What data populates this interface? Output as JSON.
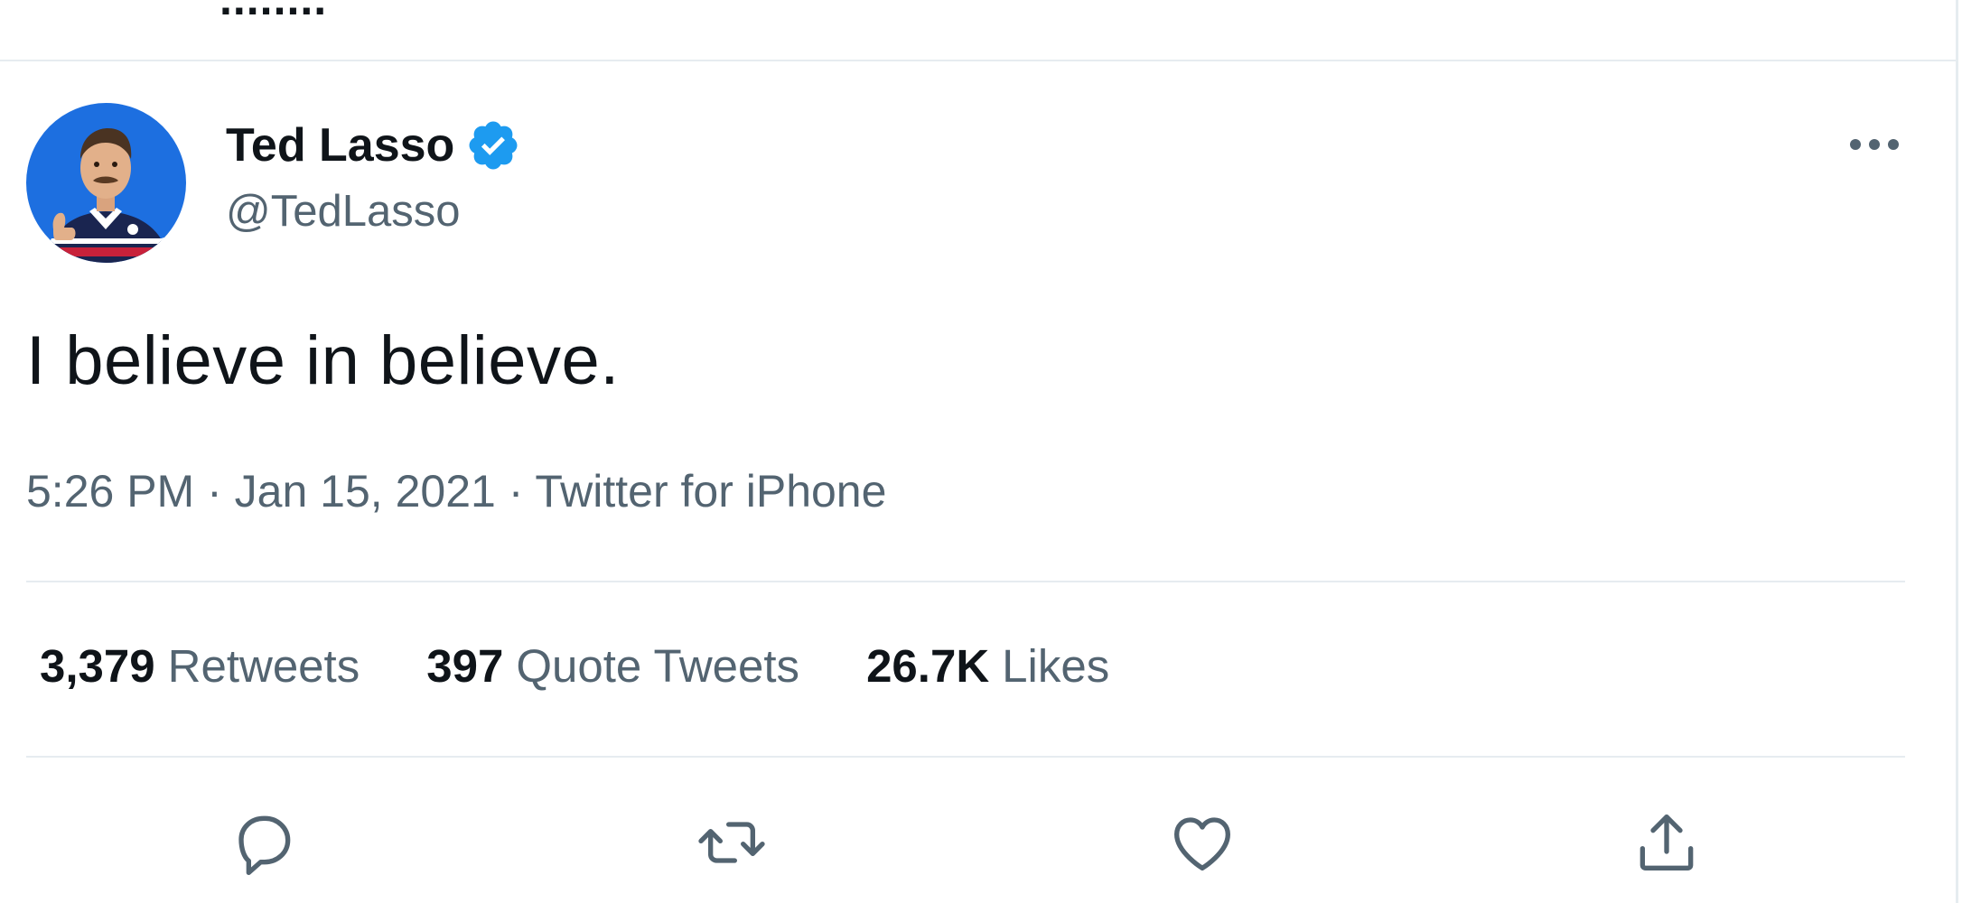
{
  "previous_tweet": {
    "partial_text": "........"
  },
  "tweet": {
    "author": {
      "display_name": "Ted Lasso",
      "handle": "@TedLasso",
      "verified": true,
      "avatar_icon": "profile-photo"
    },
    "more_icon": "more-horizontal-icon",
    "text": "I believe in believe.",
    "time": "5:26 PM",
    "separator": "·",
    "date": "Jan 15, 2021",
    "source": "Twitter for iPhone",
    "stats": {
      "retweets": {
        "count": "3,379",
        "label": "Retweets"
      },
      "quote_tweets": {
        "count": "397",
        "label": "Quote Tweets"
      },
      "likes": {
        "count": "26.7K",
        "label": "Likes"
      }
    },
    "actions": [
      "reply-icon",
      "retweet-icon",
      "like-icon",
      "share-icon"
    ]
  },
  "colors": {
    "text_primary": "#0f1419",
    "text_secondary": "#536471",
    "verified_blue": "#1d9bf0",
    "divider": "#e6ecf0"
  }
}
